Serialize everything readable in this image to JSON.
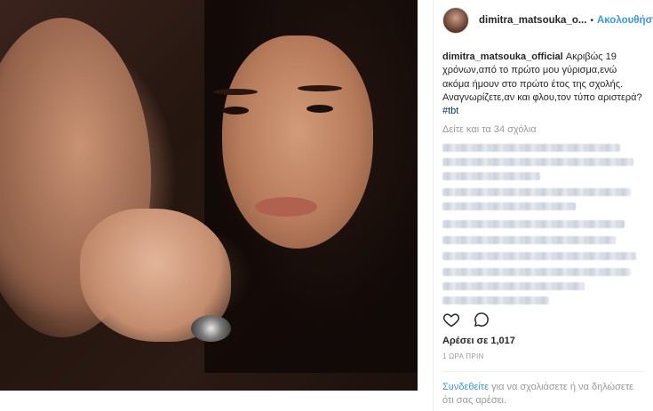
{
  "post": {
    "username_short": "dimitra_matsouka_o...",
    "separator": "•",
    "follow_label": "Ακολουθήστε",
    "caption_user": "dimitra_matsouka_official",
    "caption_text": " Ακριβώς 19 χρόνων,από το πρώτο μου γύρισμα,ενώ ακόμα ήμουν στο πρώτο έτος της σχολής. Αναγνωρίζετε,αν και φλου,τον τύπο αριστερά?",
    "hashtag": "#tbt",
    "view_all_comments": "Δείτε και τα 34 σχόλια",
    "likes": "Αρέσει σε 1,017",
    "time_ago": "1 ΩΡΑ ΠΡΙΝ",
    "login_link": "Συνδεθείτε",
    "login_text": " για να σχολιάσετε ή να δηλώσετε ότι σας αρέσει."
  },
  "icons": {
    "like": "heart-outline-icon",
    "comment": "speech-bubble-icon"
  },
  "colors": {
    "link_blue": "#3897f0",
    "text": "#262626",
    "muted": "#999999"
  }
}
